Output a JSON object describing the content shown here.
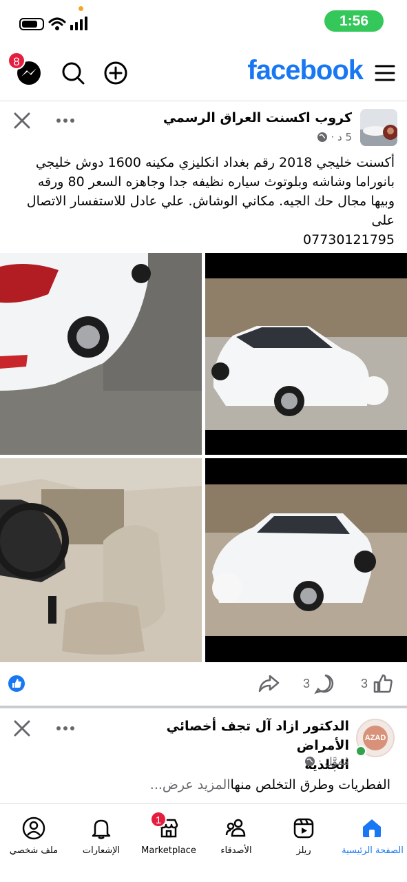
{
  "status_bar": {
    "time": "1:56"
  },
  "header": {
    "logo": "facebook",
    "messenger_badge": "8"
  },
  "post1": {
    "group_name": "كروب اكسنت العراق الرسمي",
    "time": "5 د ·",
    "lines": [
      "أكسنت خليجي 2018 رقم بغداد انكليزي مكينه 1600 دوش خليجي",
      "بانوراما وشاشه وبلوتوث  سياره نظيفه جدا وجاهزه السعر 80 ورقه",
      "وبيها مجال حك الجيه. مكاني الوشاش. علي عادل للاستفسار الاتصال",
      "على",
      "07730121795"
    ],
    "likes_count": "3",
    "comments_count": "3"
  },
  "post2": {
    "name_line1": "الدكتور ازاد آل تجف أخصائي الأمراض",
    "name_line2": "الجلدية",
    "sponsored": "مُموَّل ·",
    "avatar_text": "AZAD",
    "text": "الفطريات وطرق التخلص منها",
    "see_more": "المزيد عرض..."
  },
  "nav": {
    "home": "الصفحة الرئيسية",
    "reels": "ريلز",
    "friends": "الأصدقاء",
    "marketplace": "Marketplace",
    "marketplace_badge": "1",
    "notifications": "الإشعارات",
    "profile": "ملف شخصي"
  },
  "colors": {
    "brand": "#1877f2",
    "badge": "#e41e3f",
    "status_pill": "#34c759"
  }
}
